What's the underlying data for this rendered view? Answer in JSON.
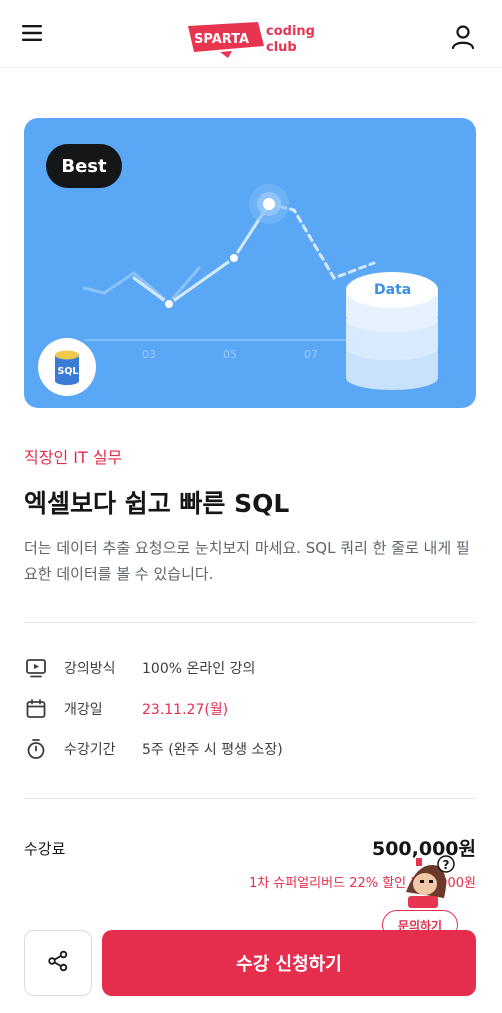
{
  "header": {
    "logo_badge": "SPARTA",
    "logo_sub": "coding",
    "logo_sub2": "club",
    "menu_icon": "hamburger-menu-icon",
    "profile_icon": "user-icon"
  },
  "hero": {
    "badge": "Best",
    "chart_ticks": [
      "03",
      "05",
      "07"
    ],
    "db_label": "Data",
    "sql_label": "SQL",
    "bg_color": "#5aa8f5"
  },
  "course": {
    "category": "직장인 IT 실무",
    "title": "엑셀보다 쉽고 빠른 SQL",
    "description": "더는 데이터 추출 요청으로 눈치보지 마세요. SQL 쿼리 한 줄로 내게 필요한 데이터를 볼 수 있습니다."
  },
  "info": [
    {
      "icon": "video-play-icon",
      "label": "강의방식",
      "value": "100% 온라인 강의"
    },
    {
      "icon": "calendar-icon",
      "label": "개강일",
      "value": "23.11.27(월)"
    },
    {
      "icon": "stopwatch-icon",
      "label": "수강기간",
      "value": "5주 (완주 시 평생 소장)"
    }
  ],
  "pricing": {
    "label": "수강료",
    "price": "500,000원",
    "discount": "1차 슈퍼얼리버드 22% 할인 390,000원"
  },
  "actions": {
    "inquiry": "문의하기",
    "apply": "수강 신청하기",
    "share_icon": "share-icon"
  },
  "colors": {
    "accent": "#e52e4d",
    "text": "#141617"
  }
}
